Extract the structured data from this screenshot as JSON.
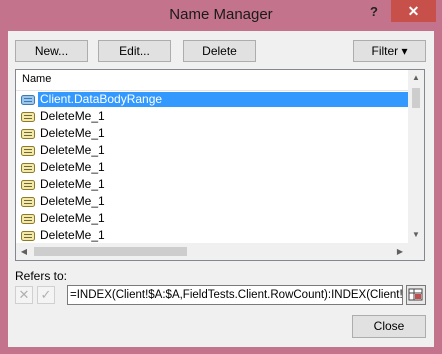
{
  "window": {
    "title": "Name Manager",
    "help_label": "?",
    "close_label": "✕"
  },
  "toolbar": {
    "new_label": "New...",
    "edit_label": "Edit...",
    "delete_label": "Delete",
    "filter_label": "Filter ▾"
  },
  "list": {
    "column_header": "Name",
    "items": [
      {
        "label": "Client.DataBodyRange",
        "selected": true,
        "icon": "table-name-icon"
      },
      {
        "label": "DeleteMe_1",
        "selected": false,
        "icon": "defined-name-icon"
      },
      {
        "label": "DeleteMe_1",
        "selected": false,
        "icon": "defined-name-icon"
      },
      {
        "label": "DeleteMe_1",
        "selected": false,
        "icon": "defined-name-icon"
      },
      {
        "label": "DeleteMe_1",
        "selected": false,
        "icon": "defined-name-icon"
      },
      {
        "label": "DeleteMe_1",
        "selected": false,
        "icon": "defined-name-icon"
      },
      {
        "label": "DeleteMe_1",
        "selected": false,
        "icon": "defined-name-icon"
      },
      {
        "label": "DeleteMe_1",
        "selected": false,
        "icon": "defined-name-icon"
      },
      {
        "label": "DeleteMe_1",
        "selected": false,
        "icon": "defined-name-icon"
      }
    ]
  },
  "refers_to": {
    "label": "Refers to:",
    "value": "=INDEX(Client!$A:$A,FieldTests.Client.RowCount):INDEX(Client!$"
  },
  "footer": {
    "close_label": "Close"
  },
  "colors": {
    "frame": "#c3748c",
    "selection": "#3399ff",
    "close_button": "#c7504a"
  }
}
